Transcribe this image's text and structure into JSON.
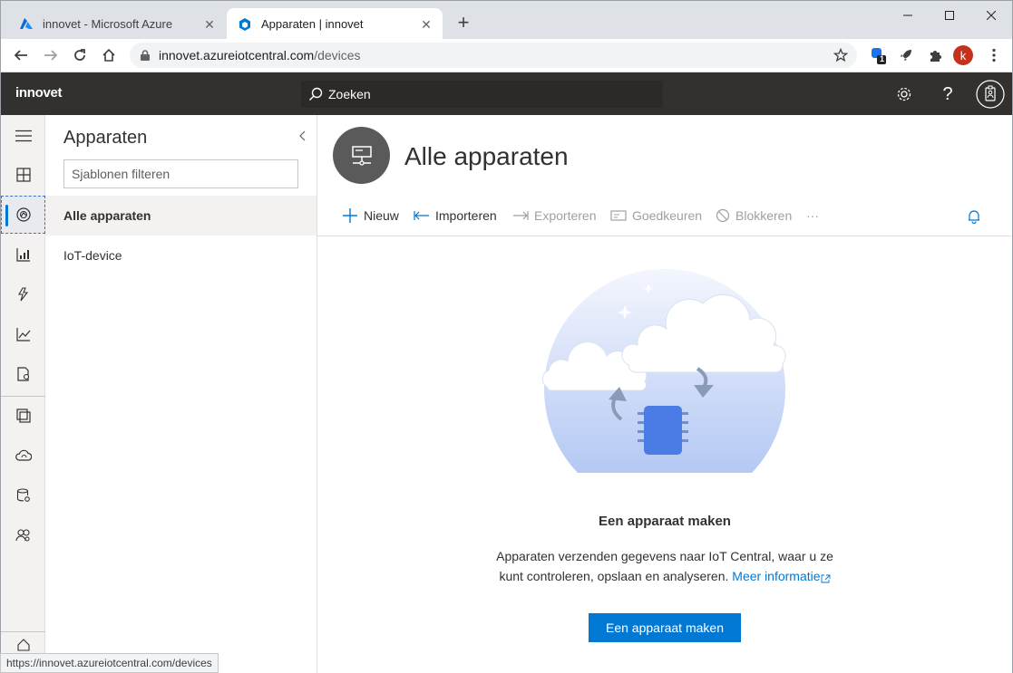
{
  "browser": {
    "tabs": [
      {
        "label": "innovet - Microsoft Azure",
        "icon": "azure-icon"
      },
      {
        "label": "Apparaten | innovet",
        "icon": "iot-central-icon"
      }
    ],
    "url_host": "innovet.azureiotcentral.com",
    "url_path": "/devices",
    "profile_initial": "k",
    "extension_badge": "1",
    "status_url": "https://innovet.azureiotcentral.com/devices"
  },
  "app": {
    "brand": "innovet",
    "search_label": "Zoeken"
  },
  "rail": {
    "items": [
      "menu-icon",
      "dashboard-icon",
      "devices-icon",
      "device-groups-icon",
      "rules-icon",
      "analytics-icon",
      "jobs-icon",
      "device-templates-icon",
      "data-export-icon",
      "administration-icon",
      "permissions-icon"
    ]
  },
  "panel": {
    "title": "Apparaten",
    "filter_placeholder": "Sjablonen filteren",
    "items": [
      {
        "label": "Alle apparaten"
      },
      {
        "label": "IoT-device"
      }
    ]
  },
  "main": {
    "title": "Alle apparaten",
    "commands": [
      {
        "label": "Nieuw",
        "icon": "plus-icon"
      },
      {
        "label": "Importeren",
        "icon": "import-icon"
      },
      {
        "label": "Exporteren",
        "icon": "export-icon"
      },
      {
        "label": "Goedkeuren",
        "icon": "approve-icon"
      },
      {
        "label": "Blokkeren",
        "icon": "block-icon"
      }
    ],
    "more": "···",
    "empty_title": "Een apparaat maken",
    "empty_desc": "Apparaten verzenden gegevens naar IoT Central, waar u ze kunt controleren, opslaan en analyseren.",
    "learn_more": "Meer informatie",
    "cta": "Een apparaat maken"
  },
  "colors": {
    "header_bg": "#323130",
    "accent": "#0078d4"
  }
}
